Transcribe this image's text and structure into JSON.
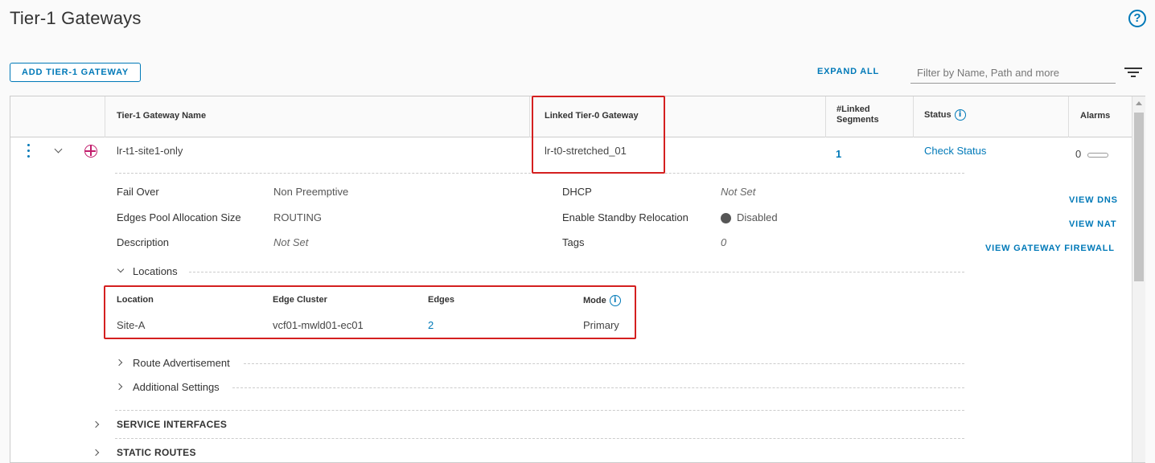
{
  "page": {
    "title": "Tier-1 Gateways"
  },
  "toolbar": {
    "add_button_label": "ADD TIER-1 GATEWAY",
    "expand_all_label": "EXPAND ALL",
    "filter_placeholder": "Filter by Name, Path and more"
  },
  "grid": {
    "columns": {
      "name": "Tier-1 Gateway Name",
      "linked_tier0": "Linked Tier-0 Gateway",
      "linked_segments": "#Linked Segments",
      "status": "Status",
      "alarms": "Alarms"
    },
    "row": {
      "name": "lr-t1-site1-only",
      "linked_tier0": "lr-t0-stretched_01",
      "linked_segments": "1",
      "status": "Check Status",
      "alarms": "0"
    }
  },
  "details": {
    "left": [
      {
        "label": "Fail Over",
        "value": "Non Preemptive",
        "italic": false
      },
      {
        "label": "Edges Pool Allocation Size",
        "value": "ROUTING",
        "italic": false
      },
      {
        "label": "Description",
        "value": "Not Set",
        "italic": true
      }
    ],
    "right": [
      {
        "label": "DHCP",
        "value": "Not Set",
        "italic": true
      },
      {
        "label": "Enable Standby Relocation",
        "value": "Disabled",
        "italic": false
      },
      {
        "label": "Tags",
        "value": "0",
        "italic": true
      }
    ],
    "actions": {
      "view_dns": "VIEW DNS",
      "view_nat": "VIEW NAT",
      "view_firewall": "VIEW GATEWAY FIREWALL"
    }
  },
  "locations": {
    "section_label": "Locations",
    "headers": {
      "location": "Location",
      "edge_cluster": "Edge Cluster",
      "edges": "Edges",
      "mode": "Mode"
    },
    "rows": [
      {
        "location": "Site-A",
        "edge_cluster": "vcf01-mwld01-ec01",
        "edges": "2",
        "mode": "Primary"
      }
    ]
  },
  "sections": {
    "route_advertisement": "Route Advertisement",
    "additional_settings": "Additional Settings",
    "service_interfaces": "SERVICE INTERFACES",
    "static_routes": "STATIC ROUTES"
  },
  "colors": {
    "accent": "#0079b8",
    "highlight_box": "#d42020",
    "gateway_icon": "#c21d6c"
  },
  "icons": [
    "help-icon",
    "filter-lines-icon",
    "kebab-menu-icon",
    "chevron-down-icon",
    "chevron-right-icon",
    "tier1-gateway-icon",
    "info-icon"
  ]
}
